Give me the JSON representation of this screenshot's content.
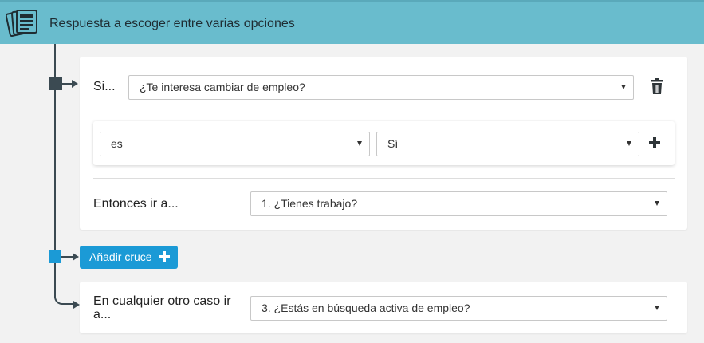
{
  "header": {
    "title": "Respuesta a escoger entre varias opciones",
    "icon": "question-list-icon"
  },
  "condition": {
    "if_label": "Si...",
    "question_value": "¿Te interesa cambiar de empleo?",
    "operator_value": "es",
    "answer_value": "Sí",
    "then_label": "Entonces ir a...",
    "then_value": "1. ¿Tienes trabajo?"
  },
  "add_cross": {
    "label": "Añadir cruce"
  },
  "otherwise": {
    "label": "En cualquier otro caso ir a...",
    "value": "3. ¿Estás en búsqueda activa de empleo?"
  },
  "colors": {
    "header": "#69bccd",
    "accent": "#1b9ad6",
    "connector": "#3b4a52"
  }
}
